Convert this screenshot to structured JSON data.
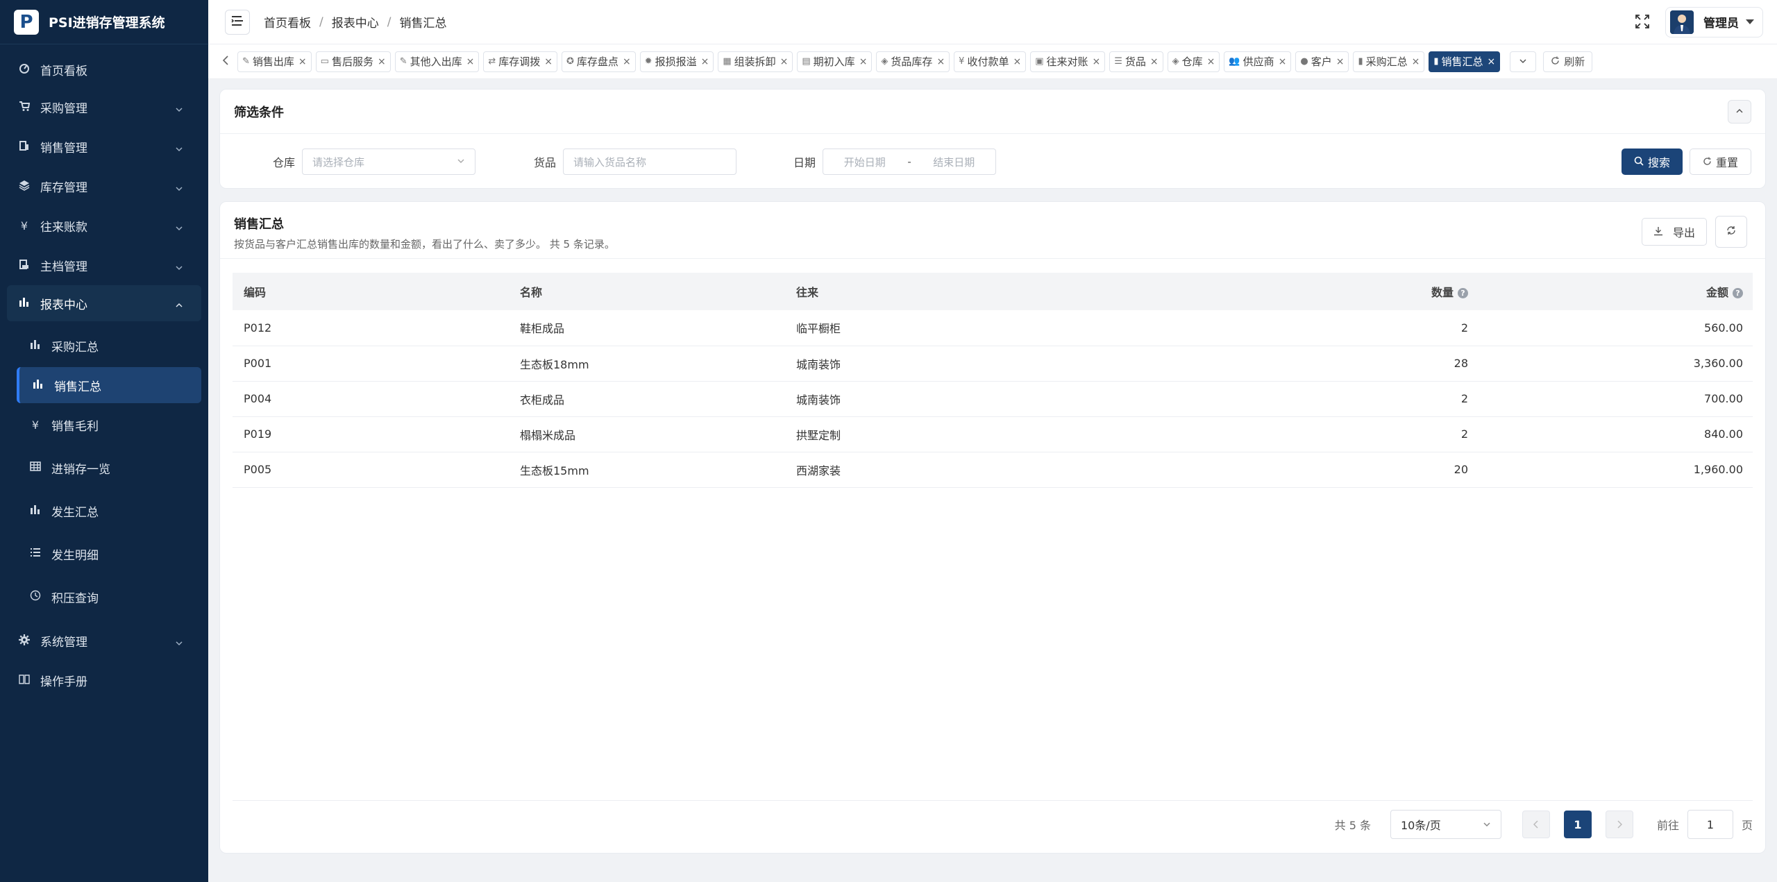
{
  "brand": {
    "logo_letter": "P",
    "title": "PSI进销存管理系统"
  },
  "sidebar": {
    "items": [
      {
        "icon": "dashboard-icon",
        "label": "首页看板"
      },
      {
        "icon": "cart-icon",
        "label": "采购管理"
      },
      {
        "icon": "sales-icon",
        "label": "销售管理"
      },
      {
        "icon": "stack-icon",
        "label": "库存管理"
      },
      {
        "icon": "yen-icon",
        "label": "往来账款"
      },
      {
        "icon": "archive-icon",
        "label": "主档管理"
      },
      {
        "icon": "chart-icon",
        "label": "报表中心"
      },
      {
        "icon": "gear-icon",
        "label": "系统管理"
      },
      {
        "icon": "book-icon",
        "label": "操作手册"
      }
    ],
    "report_sub": [
      {
        "icon": "chart-icon",
        "label": "采购汇总"
      },
      {
        "icon": "chart-icon",
        "label": "销售汇总"
      },
      {
        "icon": "yen-icon",
        "label": "销售毛利"
      },
      {
        "icon": "grid-icon",
        "label": "进销存一览"
      },
      {
        "icon": "chart-icon",
        "label": "发生汇总"
      },
      {
        "icon": "list-icon",
        "label": "发生明细"
      },
      {
        "icon": "clock-icon",
        "label": "积压查询"
      }
    ]
  },
  "header": {
    "breadcrumb": [
      "首页看板",
      "报表中心",
      "销售汇总"
    ],
    "user_name": "管理员"
  },
  "tabs": {
    "items": [
      {
        "icon": "edit-icon",
        "label": "销售出库"
      },
      {
        "icon": "briefcase-icon",
        "label": "售后服务"
      },
      {
        "icon": "edit-icon",
        "label": "其他入出库"
      },
      {
        "icon": "swap-icon",
        "label": "库存调拨"
      },
      {
        "icon": "target-icon",
        "label": "库存盘点"
      },
      {
        "icon": "bug-icon",
        "label": "报损报溢"
      },
      {
        "icon": "grid-icon",
        "label": "组装拆卸"
      },
      {
        "icon": "calendar-icon",
        "label": "期初入库"
      },
      {
        "icon": "stack-icon",
        "label": "货品库存"
      },
      {
        "icon": "yen-icon",
        "label": "收付款单"
      },
      {
        "icon": "doc-icon",
        "label": "往来对账"
      },
      {
        "icon": "list-icon",
        "label": "货品"
      },
      {
        "icon": "stack-icon",
        "label": "仓库"
      },
      {
        "icon": "users-icon",
        "label": "供应商"
      },
      {
        "icon": "user-icon",
        "label": "客户"
      },
      {
        "icon": "chart-icon",
        "label": "采购汇总"
      },
      {
        "icon": "chart-icon",
        "label": "销售汇总",
        "active": true
      }
    ],
    "refresh_label": "刷新"
  },
  "filter": {
    "title": "筛选条件",
    "warehouse_label": "仓库",
    "warehouse_placeholder": "请选择仓库",
    "goods_label": "货品",
    "goods_placeholder": "请输入货品名称",
    "date_label": "日期",
    "date_start_placeholder": "开始日期",
    "date_sep": "-",
    "date_end_placeholder": "结束日期",
    "search_label": "搜索",
    "reset_label": "重置"
  },
  "summary": {
    "title": "销售汇总",
    "description": "按货品与客户汇总销售出库的数量和金额，看出了什么、卖了多少。 共 5 条记录。",
    "export_label": "导出",
    "columns": [
      "编码",
      "名称",
      "往来",
      "数量",
      "金额"
    ],
    "rows": [
      {
        "code": "P012",
        "name": "鞋柜成品",
        "partner": "临平橱柜",
        "qty": "2",
        "amount": "560.00"
      },
      {
        "code": "P001",
        "name": "生态板18mm",
        "partner": "城南装饰",
        "qty": "28",
        "amount": "3,360.00"
      },
      {
        "code": "P004",
        "name": "衣柜成品",
        "partner": "城南装饰",
        "qty": "2",
        "amount": "700.00"
      },
      {
        "code": "P019",
        "name": "榻榻米成品",
        "partner": "拱墅定制",
        "qty": "2",
        "amount": "840.00"
      },
      {
        "code": "P005",
        "name": "生态板15mm",
        "partner": "西湖家装",
        "qty": "20",
        "amount": "1,960.00"
      }
    ]
  },
  "pager": {
    "total": "共 5 条",
    "page_size": "10条/页",
    "current": "1",
    "goto_label": "前往",
    "goto_value": "1",
    "page_suffix": "页"
  },
  "colors": {
    "sidebar_bg": "#0f2744",
    "primary": "#1b4478"
  }
}
